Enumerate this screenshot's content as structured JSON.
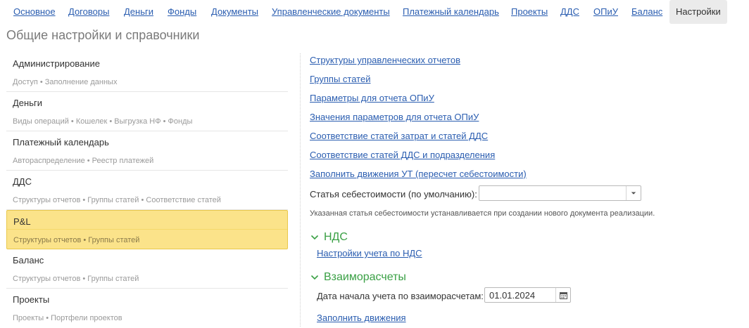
{
  "nav": {
    "tabs": [
      {
        "label": "Основное"
      },
      {
        "label": "Договоры"
      },
      {
        "label": "Деньги"
      },
      {
        "label": "Фонды"
      },
      {
        "label": "Документы"
      },
      {
        "label": "Управленческие документы"
      },
      {
        "label": "Платежный календарь"
      },
      {
        "label": "Проекты"
      },
      {
        "label": "ДДС"
      },
      {
        "label": "ОПиУ"
      },
      {
        "label": "Баланс"
      },
      {
        "label": "Настройки"
      }
    ],
    "active_tab": "Настройки"
  },
  "page": {
    "title": "Общие настройки и справочники"
  },
  "sections": [
    {
      "title": "Администрирование",
      "subtitle": "Доступ • Заполнение данных"
    },
    {
      "title": "Деньги",
      "subtitle": "Виды операций • Кошелек • Выгрузка НФ • Фонды"
    },
    {
      "title": "Платежный календарь",
      "subtitle": "Автораспределение • Реестр платежей"
    },
    {
      "title": "ДДС",
      "subtitle": "Структуры отчетов • Группы статей • Соответствие статей"
    },
    {
      "title": "P&L",
      "subtitle": "Структуры отчетов • Группы статей"
    },
    {
      "title": "Баланс",
      "subtitle": "Структуры отчетов • Группы статей"
    },
    {
      "title": "Проекты",
      "subtitle": "Проекты • Портфели проектов"
    }
  ],
  "selected_section": "P&L",
  "right": {
    "links": [
      "Структуры управленческих отчетов",
      "Группы статей",
      "Параметры для отчета ОПиУ",
      "Значения параметров для отчета ОПиУ",
      "Соответствие статей затрат и статей ДДС",
      "Соответствие статей ДДС и подразделения",
      "Заполнить движения УТ (пересчет себестоимости)"
    ],
    "cost_item_label": "Статья себестоимости (по умолчанию):",
    "cost_item_value": "",
    "cost_item_hint": "Указанная статья себестоимости устанавливается при создании нового документа реализации.",
    "vat": {
      "title": "НДС",
      "link": "Настройки учета по НДС"
    },
    "settlements": {
      "title": "Взаиморасчеты",
      "date_label": "Дата начала учета по взаиморасчетам:",
      "date_value": "01.01.2024",
      "fill_link": "Заполнить движения"
    }
  },
  "colors": {
    "link": "#2a5db0",
    "group_title": "#3aa045",
    "selected_bg": "#fbe38a",
    "active_tab_bg": "#ebebeb"
  },
  "icons": {
    "dropdown": "chevron-down-icon",
    "calendar": "calendar-icon",
    "group_toggle": "chevron-down-icon"
  }
}
